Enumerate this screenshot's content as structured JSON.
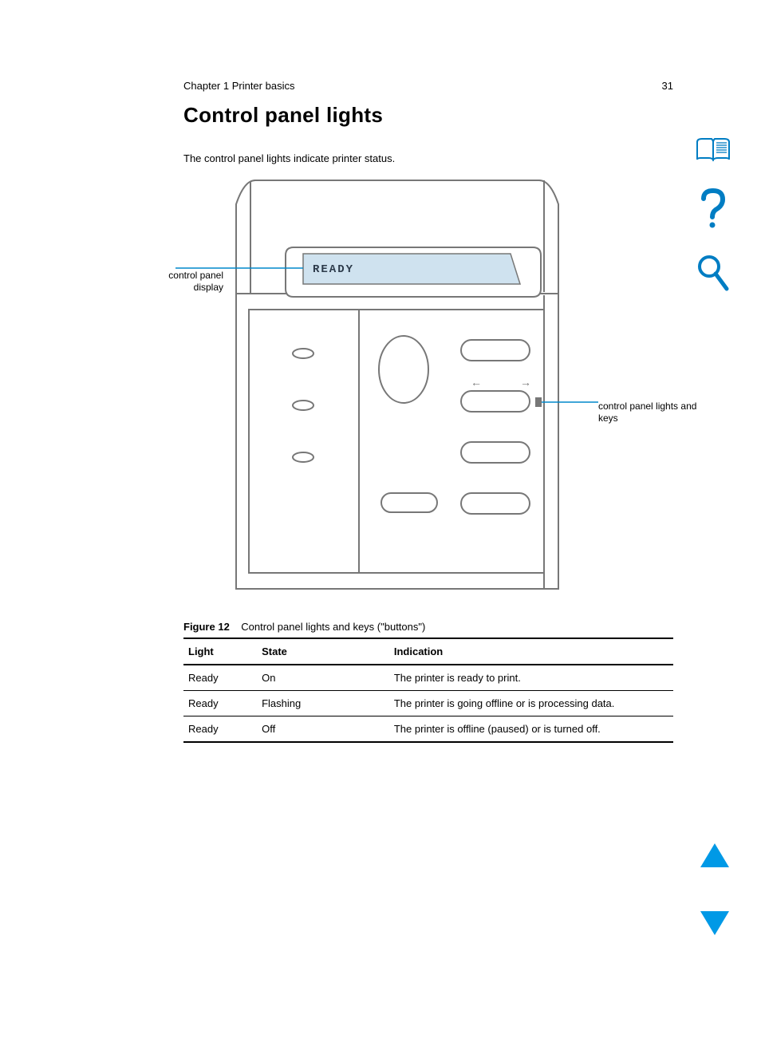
{
  "header": {
    "breadcrumb": "Chapter 1 Printer basics",
    "page_number": "31"
  },
  "title": "Control panel lights",
  "intro": "The control panel lights indicate printer status.",
  "figure": {
    "lcd_status": "READY",
    "label_left": "control panel display",
    "label_right": "control panel lights and keys",
    "caption_id": "Figure 12",
    "caption_text": "Control panel lights and keys (\"buttons\")"
  },
  "table": {
    "headers": [
      "Light",
      "State",
      "Indication"
    ],
    "rows": [
      [
        "Ready",
        "On",
        "The printer is ready to print."
      ],
      [
        "Ready",
        "Flashing",
        "The printer is going offline or is processing data."
      ],
      [
        "Ready",
        "Off",
        "The printer is offline (paused) or is turned off."
      ]
    ]
  },
  "sidebar": {
    "icons": [
      "book-icon",
      "help-icon",
      "search-icon"
    ]
  },
  "nav": {
    "prev": "previous-page",
    "next": "next-page"
  }
}
